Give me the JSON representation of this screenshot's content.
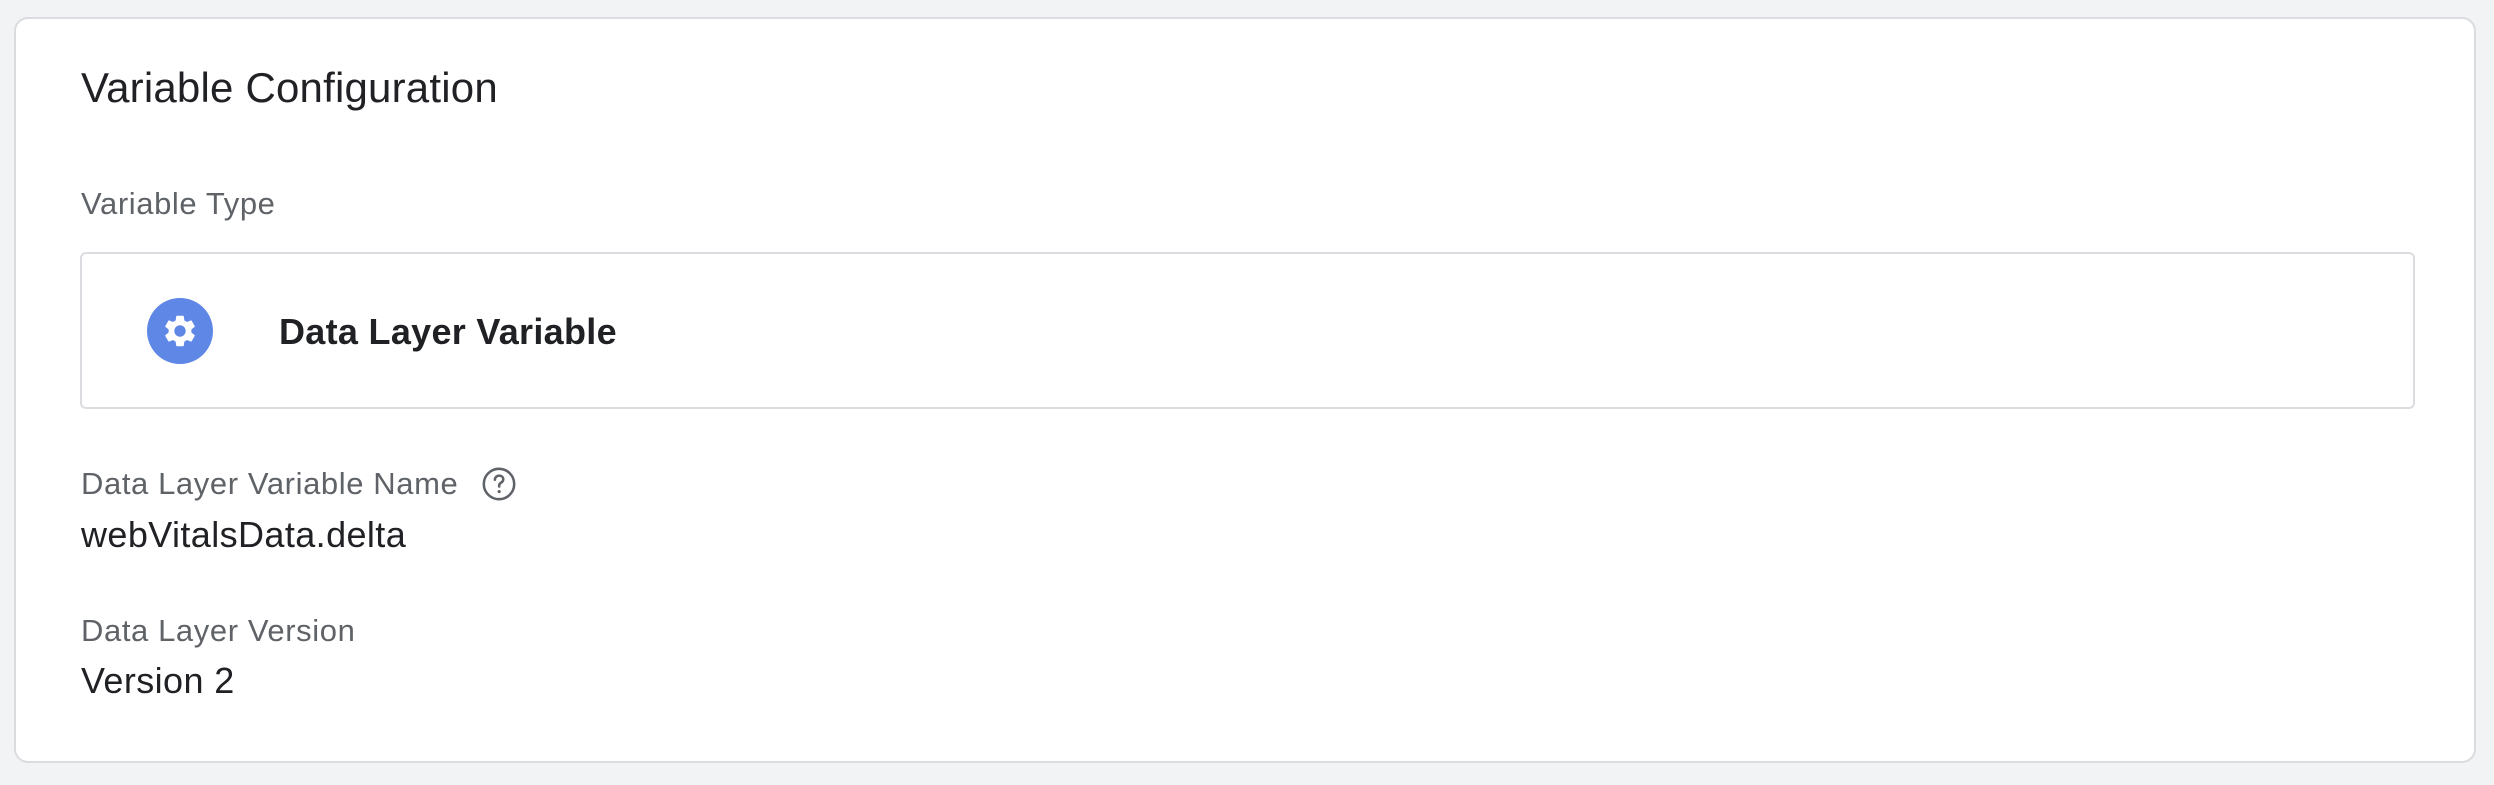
{
  "card": {
    "title": "Variable Configuration"
  },
  "variable_type": {
    "label": "Variable Type",
    "selected": "Data Layer Variable",
    "icon": "gear-icon"
  },
  "data_layer_variable_name": {
    "label": "Data Layer Variable Name",
    "value": "webVitalsData.delta",
    "help_icon": "help-circle-icon"
  },
  "data_layer_version": {
    "label": "Data Layer Version",
    "value": "Version 2"
  },
  "colors": {
    "page_background": "#f1f3f4",
    "card_background": "#ffffff",
    "border": "#dadce0",
    "icon_accent": "#5f87e6",
    "primary_text": "#202124",
    "secondary_text": "#5f6368"
  }
}
